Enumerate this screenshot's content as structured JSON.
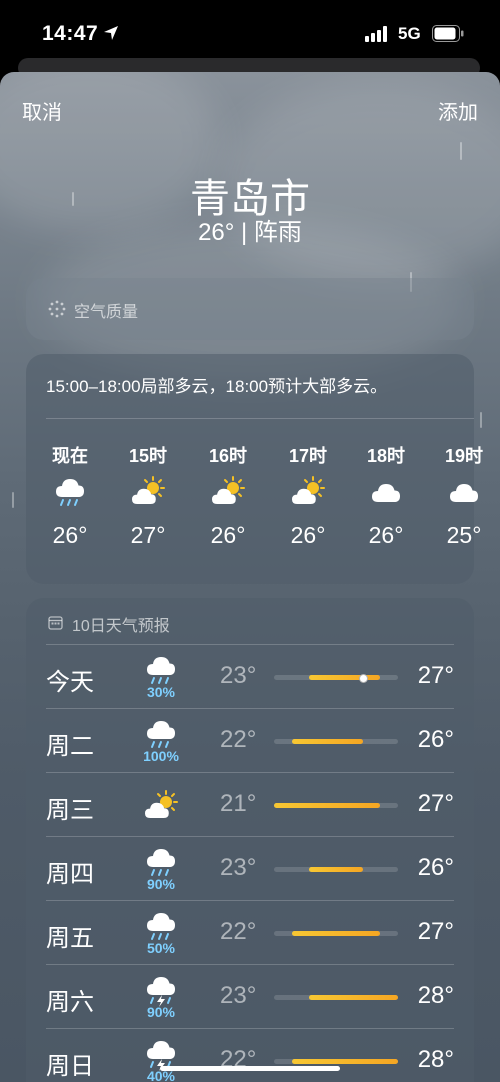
{
  "status_bar": {
    "time": "14:47",
    "network": "5G"
  },
  "sheet": {
    "cancel_label": "取消",
    "add_label": "添加"
  },
  "location": {
    "city": "青岛市",
    "current": "26° | 阵雨"
  },
  "air_quality": {
    "label": "空气质量"
  },
  "hourly": {
    "summary": "15:00–18:00局部多云，18:00预计大部多云。",
    "items": [
      {
        "label": "现在",
        "icon": "cloud-rain",
        "temp": "26°"
      },
      {
        "label": "15时",
        "icon": "cloud-sun",
        "temp": "27°"
      },
      {
        "label": "16时",
        "icon": "cloud-sun",
        "temp": "26°"
      },
      {
        "label": "17时",
        "icon": "cloud-sun",
        "temp": "26°"
      },
      {
        "label": "18时",
        "icon": "cloud",
        "temp": "26°"
      },
      {
        "label": "19时",
        "icon": "cloud",
        "temp": "25°"
      }
    ]
  },
  "daily": {
    "header": "10日天气预报",
    "range_min": 21,
    "range_max": 28,
    "items": [
      {
        "day": "今天",
        "icon": "cloud-rain",
        "precip": "30%",
        "low": "23°",
        "high": "27°",
        "low_value": 23,
        "high_value": 27,
        "current_value": 26
      },
      {
        "day": "周二",
        "icon": "cloud-rain",
        "precip": "100%",
        "low": "22°",
        "high": "26°",
        "low_value": 22,
        "high_value": 26
      },
      {
        "day": "周三",
        "icon": "cloud-sun",
        "precip": "",
        "low": "21°",
        "high": "27°",
        "low_value": 21,
        "high_value": 27
      },
      {
        "day": "周四",
        "icon": "cloud-rain",
        "precip": "90%",
        "low": "23°",
        "high": "26°",
        "low_value": 23,
        "high_value": 26
      },
      {
        "day": "周五",
        "icon": "cloud-rain",
        "precip": "50%",
        "low": "22°",
        "high": "27°",
        "low_value": 22,
        "high_value": 27
      },
      {
        "day": "周六",
        "icon": "cloud-bolt-rain",
        "precip": "90%",
        "low": "23°",
        "high": "28°",
        "low_value": 23,
        "high_value": 28
      },
      {
        "day": "周日",
        "icon": "cloud-bolt-rain",
        "precip": "40%",
        "low": "22°",
        "high": "28°",
        "low_value": 22,
        "high_value": 28
      }
    ]
  },
  "colors": {
    "precip": "#7fd0ff",
    "bar_start": "#f7c733",
    "bar_end": "#f5a623",
    "sun": "#f5c125"
  }
}
